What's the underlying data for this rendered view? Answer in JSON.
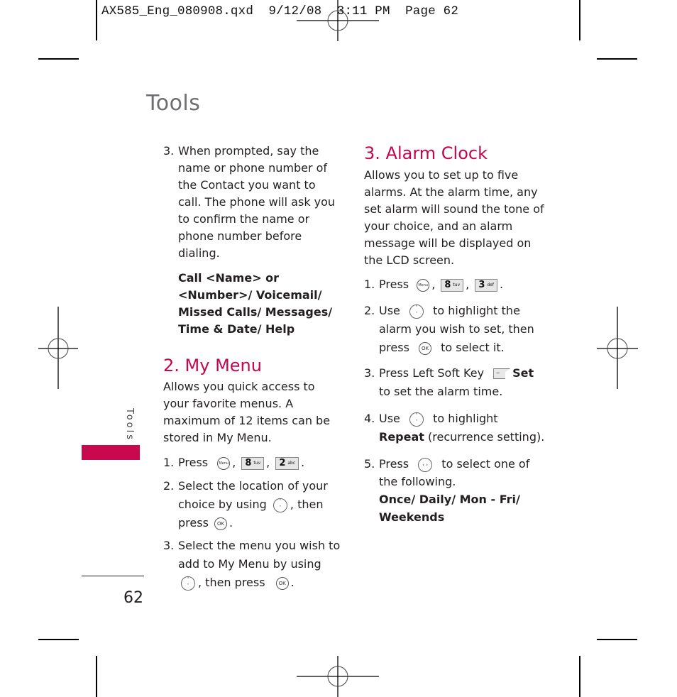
{
  "slug_line": {
    "filename": "AX585_Eng_080908.qxd",
    "date": "9/12/08",
    "time": "3:11 PM",
    "page_label": "Page 62"
  },
  "page": {
    "title": "Tools",
    "side_tab_label": "Tools",
    "page_number": "62",
    "accent_color": "#c8094e"
  },
  "left_column": {
    "voice_step": {
      "num": "3.",
      "text": "When prompted, say the name or phone number of the Contact you want to call. The phone will ask you to confirm the name or phone number before dialing."
    },
    "voice_commands": "Call <Name> or <Number>/ Voicemail/ Missed Calls/ Messages/ Time & Date/ Help",
    "my_menu": {
      "heading": "2. My Menu",
      "intro": "Allows you quick access to your favorite menus. A maximum of 12 items can be stored in My Menu.",
      "step1": {
        "num": "1.",
        "press": "Press",
        "menu_key": "Menu",
        "key1": "8",
        "key1_letters": "tuv",
        "key2": "2",
        "key2_letters": "abc"
      },
      "step2": {
        "num": "2.",
        "text_a": "Select the location of your choice by using",
        "text_b": ", then press",
        "ok_key": "OK"
      },
      "step3": {
        "num": "3.",
        "text_a": "Select the menu you wish to add to My Menu by using",
        "text_b": ", then press",
        "ok_key": "OK"
      }
    }
  },
  "right_column": {
    "heading": "3. Alarm Clock",
    "intro": "Allows you to set up to five alarms. At the alarm time, any set alarm will sound the tone of your choice, and an alarm message will be displayed on the LCD screen.",
    "step1": {
      "num": "1.",
      "press": "Press",
      "menu_key": "Menu",
      "key1": "8",
      "key1_letters": "tuv",
      "key2": "3",
      "key2_letters": "def"
    },
    "step2": {
      "num": "2.",
      "text_a": "Use",
      "text_b": "to highlight the alarm you wish to set, then press",
      "text_c": "to select it.",
      "ok_key": "OK"
    },
    "step3": {
      "num": "3.",
      "text_a": "Press Left Soft Key",
      "bold": "Set",
      "text_b": "to set the alarm time."
    },
    "step4": {
      "num": "4.",
      "text_a": "Use",
      "text_b": "to highlight",
      "bold": "Repeat",
      "text_c": "(recurrence setting)."
    },
    "step5": {
      "num": "5.",
      "text_a": "Press",
      "text_b": "to select one of the following.",
      "options": "Once/ Daily/ Mon - Fri/ Weekends"
    }
  }
}
